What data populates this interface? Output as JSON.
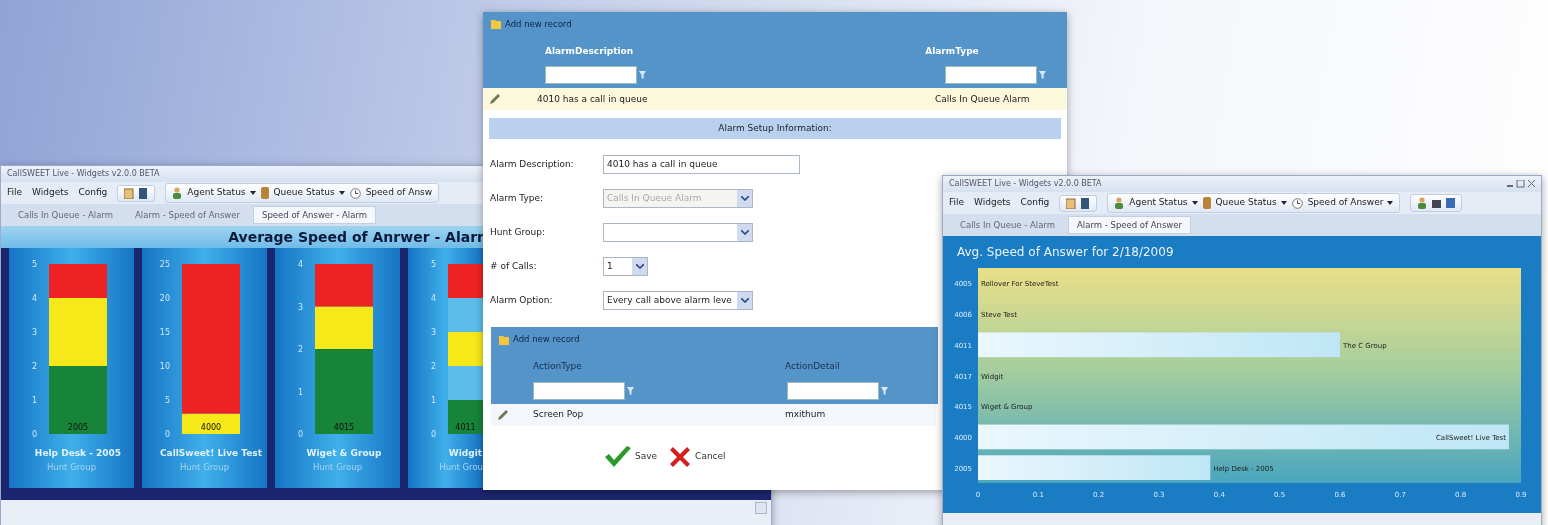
{
  "left_window": {
    "title": "CallSWEET Live - Widgets v2.0.0 BETA",
    "menu": [
      "File",
      "Widgets",
      "Config"
    ],
    "toolbar": [
      {
        "label": "Agent Status",
        "dropdown": true
      },
      {
        "label": "Queue Status",
        "dropdown": true
      },
      {
        "label": "Speed of Answ",
        "dropdown": false
      }
    ],
    "tabs": [
      {
        "label": "Calls In Queue - Alarm",
        "selected": false
      },
      {
        "label": "Alarm - Speed of Answer",
        "selected": false
      },
      {
        "label": "Speed of Answer - Alarm",
        "selected": true
      }
    ],
    "header": "Average Speed of Anrwer - Alarr",
    "gauges": [
      {
        "group": "Hunt Group",
        "value_label": "2005",
        "chart_data": {
          "type": "bar",
          "stacked": true,
          "categories": [
            "Help Desk - 2005"
          ],
          "ylim": [
            0,
            5
          ],
          "yticks": [
            0,
            1,
            2,
            3,
            4,
            5
          ],
          "series": [
            {
              "color": "#17843a",
              "values": [
                2
              ]
            },
            {
              "color": "#f7e81a",
              "values": [
                2
              ]
            },
            {
              "color": "#ee2222",
              "values": [
                1
              ]
            }
          ]
        }
      },
      {
        "group": "Hunt Group",
        "value_label": "4000",
        "chart_data": {
          "type": "bar",
          "stacked": true,
          "categories": [
            "CallSweet! Live Test"
          ],
          "ylim": [
            0,
            25
          ],
          "yticks": [
            0,
            5,
            10,
            15,
            20,
            25
          ],
          "series": [
            {
              "color": "#f7e81a",
              "values": [
                3
              ]
            },
            {
              "color": "#ee2222",
              "values": [
                22
              ]
            }
          ]
        }
      },
      {
        "group": "Hunt Group",
        "value_label": "4015",
        "chart_data": {
          "type": "bar",
          "stacked": true,
          "categories": [
            "Wiget & Group"
          ],
          "ylim": [
            0,
            4
          ],
          "yticks": [
            0,
            1,
            2,
            3,
            4
          ],
          "series": [
            {
              "color": "#17843a",
              "values": [
                2
              ]
            },
            {
              "color": "#f7e81a",
              "values": [
                1
              ]
            },
            {
              "color": "#ee2222",
              "values": [
                1
              ]
            }
          ]
        }
      },
      {
        "group": "Hunt Grou",
        "value_label": "4011",
        "chart_data": {
          "type": "bar",
          "stacked": true,
          "categories": [
            "Widgit"
          ],
          "ylim": [
            0,
            5
          ],
          "yticks": [
            0,
            1,
            2,
            3,
            4,
            5
          ],
          "series": [
            {
              "color": "#17843a",
              "values": [
                1
              ]
            },
            {
              "color": "#5cbdea",
              "values": [
                1
              ]
            },
            {
              "color": "#f7e81a",
              "values": [
                1
              ]
            },
            {
              "color": "#5cbdea",
              "values": [
                1
              ]
            },
            {
              "color": "#ee2222",
              "values": [
                1
              ]
            }
          ]
        }
      }
    ]
  },
  "dialog": {
    "add_label": "Add new record",
    "columns": [
      "AlarmDescription",
      "AlarmType"
    ],
    "rows": [
      {
        "cells": [
          "4010 has a call in queue",
          "Calls In Queue Alarm"
        ],
        "selected": true
      }
    ],
    "section_title": "Alarm Setup Information:",
    "fields": [
      {
        "label": "Alarm Description:",
        "kind": "text",
        "value": "4010 has a call in queue",
        "disabled": false
      },
      {
        "label": "Alarm Type:",
        "kind": "select",
        "value": "Calls In Queue Alarm",
        "disabled": true
      },
      {
        "label": "Hunt Group:",
        "kind": "select",
        "disabled": false
      },
      {
        "label": "# of Calls:",
        "kind": "small-select",
        "value": "1",
        "disabled": false
      },
      {
        "label": "Alarm Option:",
        "kind": "select",
        "value": "Every call above alarm leve",
        "disabled": false
      }
    ],
    "actions": {
      "add_label": "Add new record",
      "columns": [
        "ActionType",
        "ActionDetail"
      ],
      "rows": [
        {
          "cells": [
            "Screen Pop",
            "mxithum"
          ],
          "selected": false
        }
      ]
    },
    "buttons": [
      {
        "kind": "save",
        "label": "Save"
      },
      {
        "kind": "cancel",
        "label": "Cancel"
      }
    ]
  },
  "right_window": {
    "title": "CallSWEET Live - Widgets v2.0.0 BETA",
    "menu": [
      "File",
      "Widgets",
      "Config"
    ],
    "toolbar": [
      {
        "label": "Agent Status",
        "dropdown": true
      },
      {
        "label": "Queue Status",
        "dropdown": true
      },
      {
        "label": "Speed of Answer",
        "dropdown": true
      }
    ],
    "tabs": [
      {
        "label": "Calls In Queue - Alarm",
        "selected": false
      },
      {
        "label": "Alarm - Speed of Answer",
        "selected": true
      }
    ],
    "chart_data": {
      "type": "bar",
      "orientation": "horizontal",
      "title": "Avg. Speed of Answer for 2/18/2009",
      "categories": [
        "4005",
        "4006",
        "4011",
        "4017",
        "4015",
        "4000",
        "2005"
      ],
      "values": [
        0,
        0,
        0.6,
        0,
        0,
        0.88,
        0.385
      ],
      "annotations": [
        {
          "text": "Rollover For SteveTest",
          "x": 0,
          "y": "4005"
        },
        {
          "text": "Steve Test",
          "x": 0,
          "y": "4006"
        },
        {
          "text": "The C Group",
          "x": 0.6,
          "y": "4011"
        },
        {
          "text": "Widgit",
          "x": 0,
          "y": "4017"
        },
        {
          "text": "Wiget & Group",
          "x": 0,
          "y": "4015"
        },
        {
          "text": "CallSweet! Live Test",
          "x": 0.88,
          "y": "4000"
        },
        {
          "text": "Help Desk - 2005",
          "x": 0.385,
          "y": "2005"
        }
      ],
      "xlim": [
        0,
        0.9
      ],
      "xticks": [
        {
          "value": 0,
          "label": "0"
        },
        {
          "value": 0.1,
          "label": "0.1"
        },
        {
          "value": 0.2,
          "label": "0.2"
        },
        {
          "value": 0.3,
          "label": "0.3"
        },
        {
          "value": 0.4,
          "label": "0.4"
        },
        {
          "value": 0.5,
          "label": "0.5"
        },
        {
          "value": 0.6,
          "label": "0.6"
        },
        {
          "value": 0.7,
          "label": "0.7"
        },
        {
          "value": 0.8,
          "label": "0.8"
        },
        {
          "value": 0.9,
          "label": "0.9"
        }
      ]
    }
  }
}
